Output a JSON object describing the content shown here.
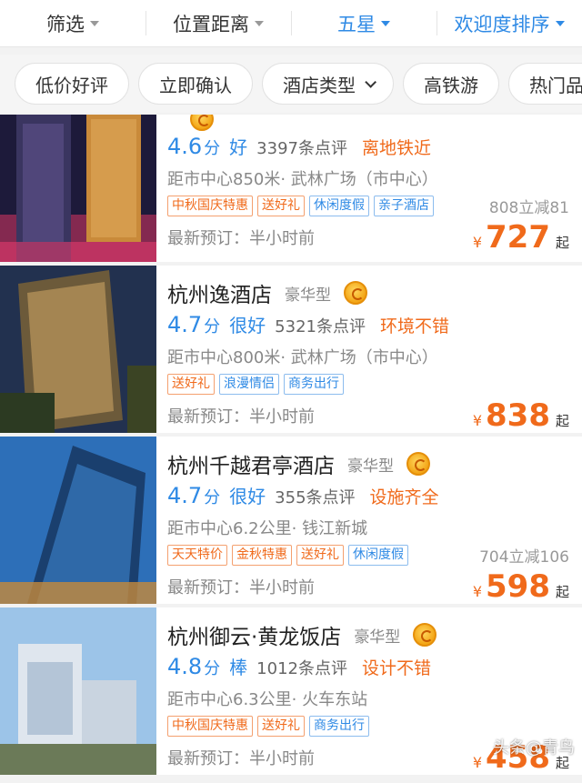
{
  "filters": [
    {
      "label": "筛选",
      "active": false
    },
    {
      "label": "位置距离",
      "active": false
    },
    {
      "label": "五星",
      "active": true
    },
    {
      "label": "欢迎度排序",
      "active": true
    }
  ],
  "quick_tags": [
    "低价好评",
    "立即确认",
    "酒店类型",
    "高铁游",
    "热门品牌"
  ],
  "hotels": [
    {
      "name": "",
      "star_type": "",
      "score": "4.6",
      "score_unit": "分",
      "level": "好",
      "reviews": "3397条点评",
      "highlight": "离地铁近",
      "location": "距市中心850米· 武林广场（市中心）",
      "tags": [
        {
          "text": "中秋国庆特惠",
          "color": "orange"
        },
        {
          "text": "送好礼",
          "color": "orange"
        },
        {
          "text": "休闲度假",
          "color": "blue"
        },
        {
          "text": "亲子酒店",
          "color": "blue"
        }
      ],
      "promo": "808立减81",
      "booking": "最新预订：半小时前",
      "currency": "¥",
      "price": "727",
      "price_suffix": "起"
    },
    {
      "name": "杭州逸酒店",
      "star_type": "豪华型",
      "score": "4.7",
      "score_unit": "分",
      "level": "很好",
      "reviews": "5321条点评",
      "highlight": "环境不错",
      "location": "距市中心800米· 武林广场（市中心）",
      "tags": [
        {
          "text": "送好礼",
          "color": "orange"
        },
        {
          "text": "浪漫情侣",
          "color": "blue"
        },
        {
          "text": "商务出行",
          "color": "blue"
        }
      ],
      "promo": "",
      "booking": "最新预订：半小时前",
      "currency": "¥",
      "price": "838",
      "price_suffix": "起"
    },
    {
      "name": "杭州千越君亭酒店",
      "star_type": "豪华型",
      "score": "4.7",
      "score_unit": "分",
      "level": "很好",
      "reviews": "355条点评",
      "highlight": "设施齐全",
      "location": "距市中心6.2公里· 钱江新城",
      "tags": [
        {
          "text": "天天特价",
          "color": "orange"
        },
        {
          "text": "金秋特惠",
          "color": "orange"
        },
        {
          "text": "送好礼",
          "color": "orange"
        },
        {
          "text": "休闲度假",
          "color": "blue"
        }
      ],
      "promo": "704立减106",
      "booking": "最新预订：半小时前",
      "currency": "¥",
      "price": "598",
      "price_suffix": "起"
    },
    {
      "name": "杭州御云·黄龙饭店",
      "star_type": "豪华型",
      "score": "4.8",
      "score_unit": "分",
      "level": "棒",
      "reviews": "1012条点评",
      "highlight": "设计不错",
      "location": "距市中心6.3公里· 火车东站",
      "tags": [
        {
          "text": "中秋国庆特惠",
          "color": "orange"
        },
        {
          "text": "送好礼",
          "color": "orange"
        },
        {
          "text": "商务出行",
          "color": "blue"
        }
      ],
      "promo": "",
      "booking": "最新预订：半小时前",
      "currency": "¥",
      "price": "458",
      "price_suffix": "起"
    }
  ],
  "watermark": "头条@青鸟"
}
